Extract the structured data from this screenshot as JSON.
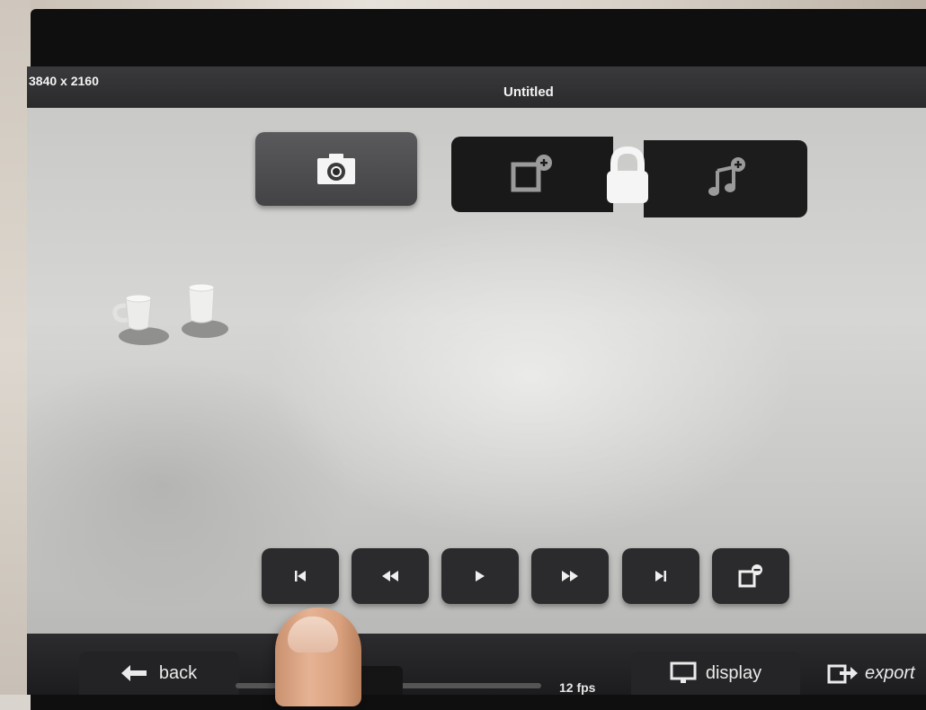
{
  "window": {
    "resolution": "3840 x 2160",
    "title": "Untitled"
  },
  "toolbar": {
    "camera_icon": "camera-icon",
    "add_frame_icon": "add-frame-icon",
    "lock_icon": "lock-icon",
    "add_music_icon": "add-music-icon"
  },
  "playback": {
    "buttons": [
      {
        "name": "first-frame",
        "icon": "skip-to-start-icon"
      },
      {
        "name": "rewind",
        "icon": "rewind-icon"
      },
      {
        "name": "play",
        "icon": "play-icon"
      },
      {
        "name": "fast-forward",
        "icon": "fast-forward-icon"
      },
      {
        "name": "last-frame",
        "icon": "skip-to-end-icon"
      },
      {
        "name": "remove-frame",
        "icon": "remove-frame-icon"
      }
    ]
  },
  "bottom_bar": {
    "back_label": "back",
    "fps_label": "12 fps",
    "display_label": "display",
    "export_label": "export"
  },
  "colors": {
    "bar_dark": "#2b2b2d",
    "icon_white": "#f2f2f2",
    "canvas_gray": "#cfcfcd"
  }
}
